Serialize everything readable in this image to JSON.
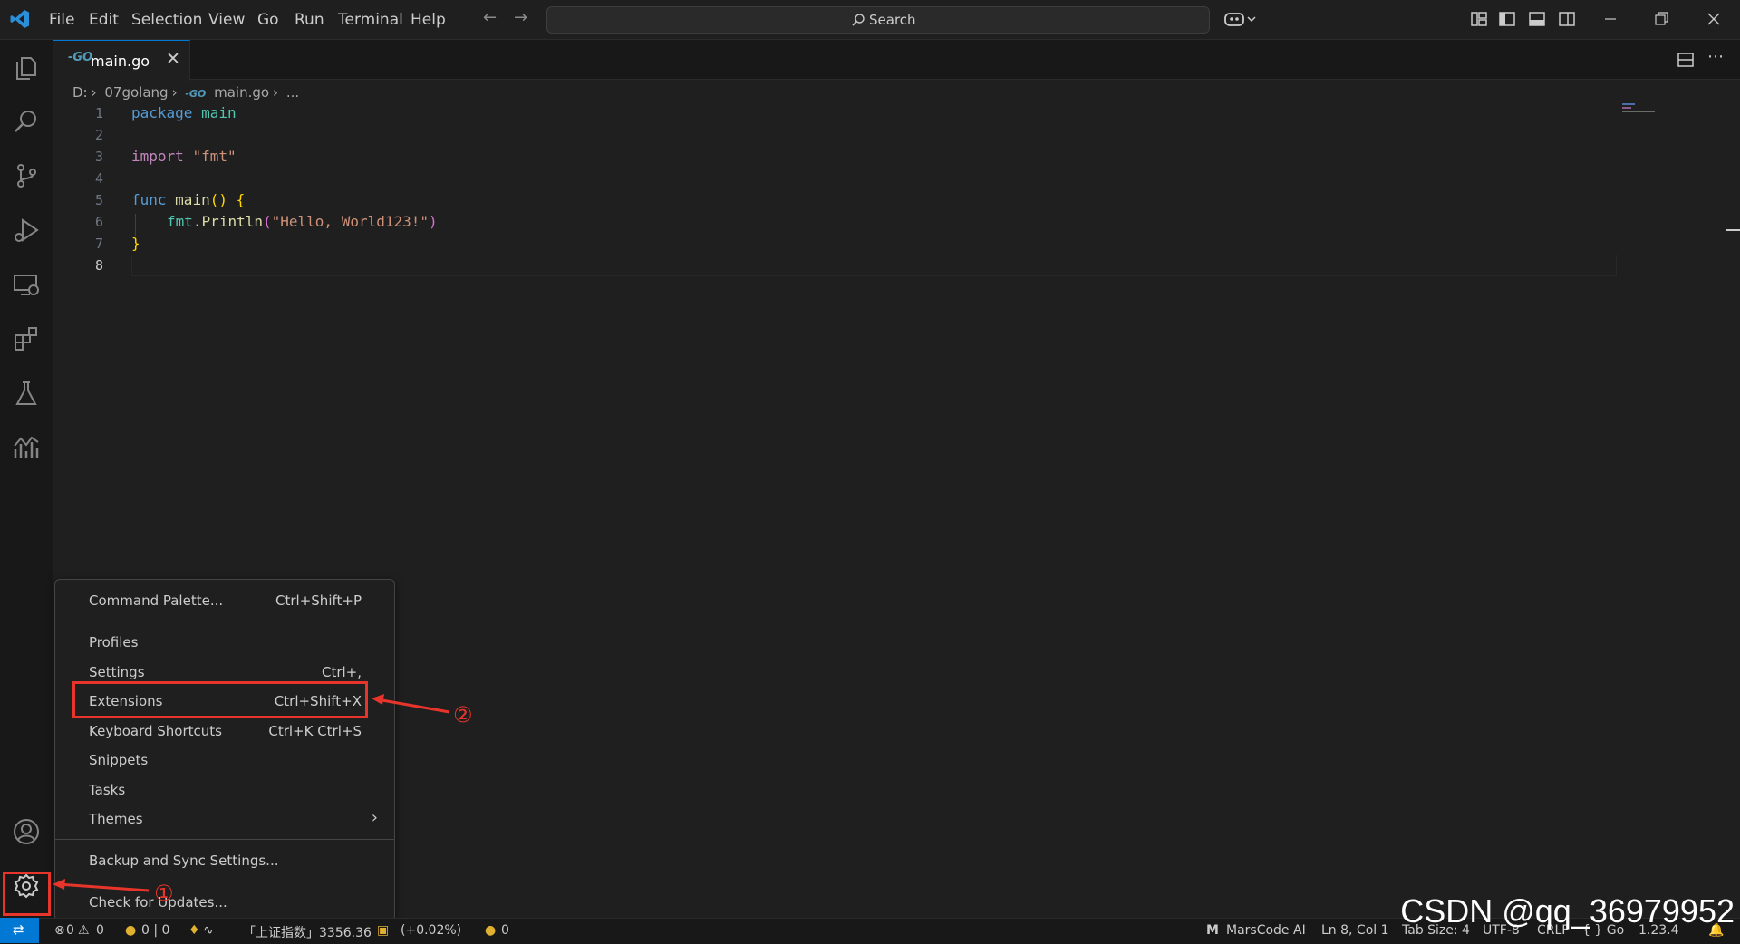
{
  "titlebar": {
    "menu": [
      "File",
      "Edit",
      "Selection",
      "View",
      "Go",
      "Run",
      "Terminal",
      "Help"
    ],
    "search_label": "Search"
  },
  "tab": {
    "name": "main.go",
    "close": "✕"
  },
  "breadcrumb": {
    "drive": "D:",
    "folder": "07golang",
    "file": "main.go",
    "more": "..."
  },
  "editor": {
    "line_numbers": [
      "1",
      "2",
      "3",
      "4",
      "5",
      "6",
      "7",
      "8"
    ],
    "lines": [
      {
        "tokens": [
          [
            "kw",
            "package"
          ],
          [
            "",
            "&sp;"
          ],
          [
            "ty",
            "main"
          ]
        ]
      }
    ],
    "code": {
      "l1_kw": "package",
      "l1_id": "main",
      "l3_kw": "import",
      "l3_str": "\"fmt\"",
      "l5_kw": "func",
      "l5_fn": "main",
      "l5_rest": "() {",
      "l6_pkg": "fmt",
      "l6_dot": ".",
      "l6_fn": "Println",
      "l6_open": "(",
      "l6_str": "\"Hello, World123!\"",
      "l6_close": ")",
      "l7": "}"
    }
  },
  "context_menu": {
    "items": [
      {
        "label": "Command Palette...",
        "key": "Ctrl+Shift+P"
      },
      {
        "label": "Profiles",
        "key": ""
      },
      {
        "label": "Settings",
        "key": "Ctrl+,"
      },
      {
        "label": "Extensions",
        "key": "Ctrl+Shift+X"
      },
      {
        "label": "Keyboard Shortcuts",
        "key": "Ctrl+K Ctrl+S"
      },
      {
        "label": "Snippets",
        "key": ""
      },
      {
        "label": "Tasks",
        "key": ""
      },
      {
        "label": "Themes",
        "key": "›"
      },
      {
        "label": "Backup and Sync Settings...",
        "key": ""
      },
      {
        "label": "Check for Updates...",
        "key": ""
      }
    ]
  },
  "annotations": {
    "one": "①",
    "two": "②"
  },
  "statusbar": {
    "errors": "0",
    "warnings": "0",
    "coins": "0 | 0",
    "index": "「上证指数」3356.36",
    "change": "(+0.02%)",
    "coin_count": "0",
    "marscode": "MarsCode AI",
    "position": "Ln 8, Col 1",
    "tabsize": "Tab Size: 4",
    "encoding": "UTF-8",
    "eol": "CRLF",
    "language": "{ } Go",
    "version": "1.23.4"
  },
  "watermark": "CSDN @qq_36979952",
  "colors": {
    "accent": "#0078d4",
    "annotation_red": "#e8352b"
  }
}
